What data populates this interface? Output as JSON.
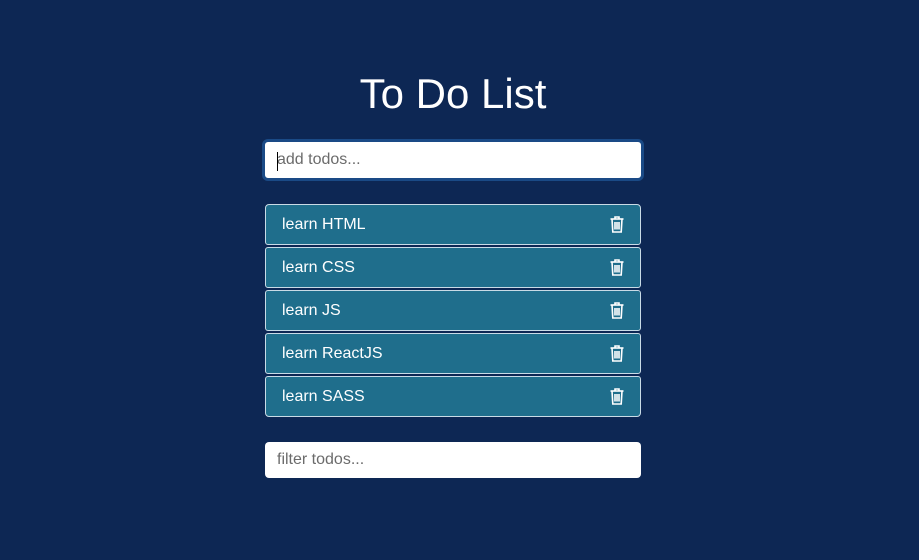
{
  "app": {
    "title": "To Do List"
  },
  "add_todo": {
    "placeholder": "add todos...",
    "value": ""
  },
  "todos": [
    {
      "label": "learn HTML",
      "icon": "trash-icon"
    },
    {
      "label": "learn CSS",
      "icon": "trash-icon"
    },
    {
      "label": "learn JS",
      "icon": "trash-icon"
    },
    {
      "label": "learn ReactJS",
      "icon": "trash-icon"
    },
    {
      "label": "learn SASS",
      "icon": "trash-icon"
    }
  ],
  "filter": {
    "placeholder": "filter todos...",
    "value": ""
  },
  "colors": {
    "background": "#0d2754",
    "item_background": "#1f6e8c",
    "item_border": "#c9dbe6",
    "focus_ring": "#1a4a86",
    "text": "#ffffff"
  }
}
